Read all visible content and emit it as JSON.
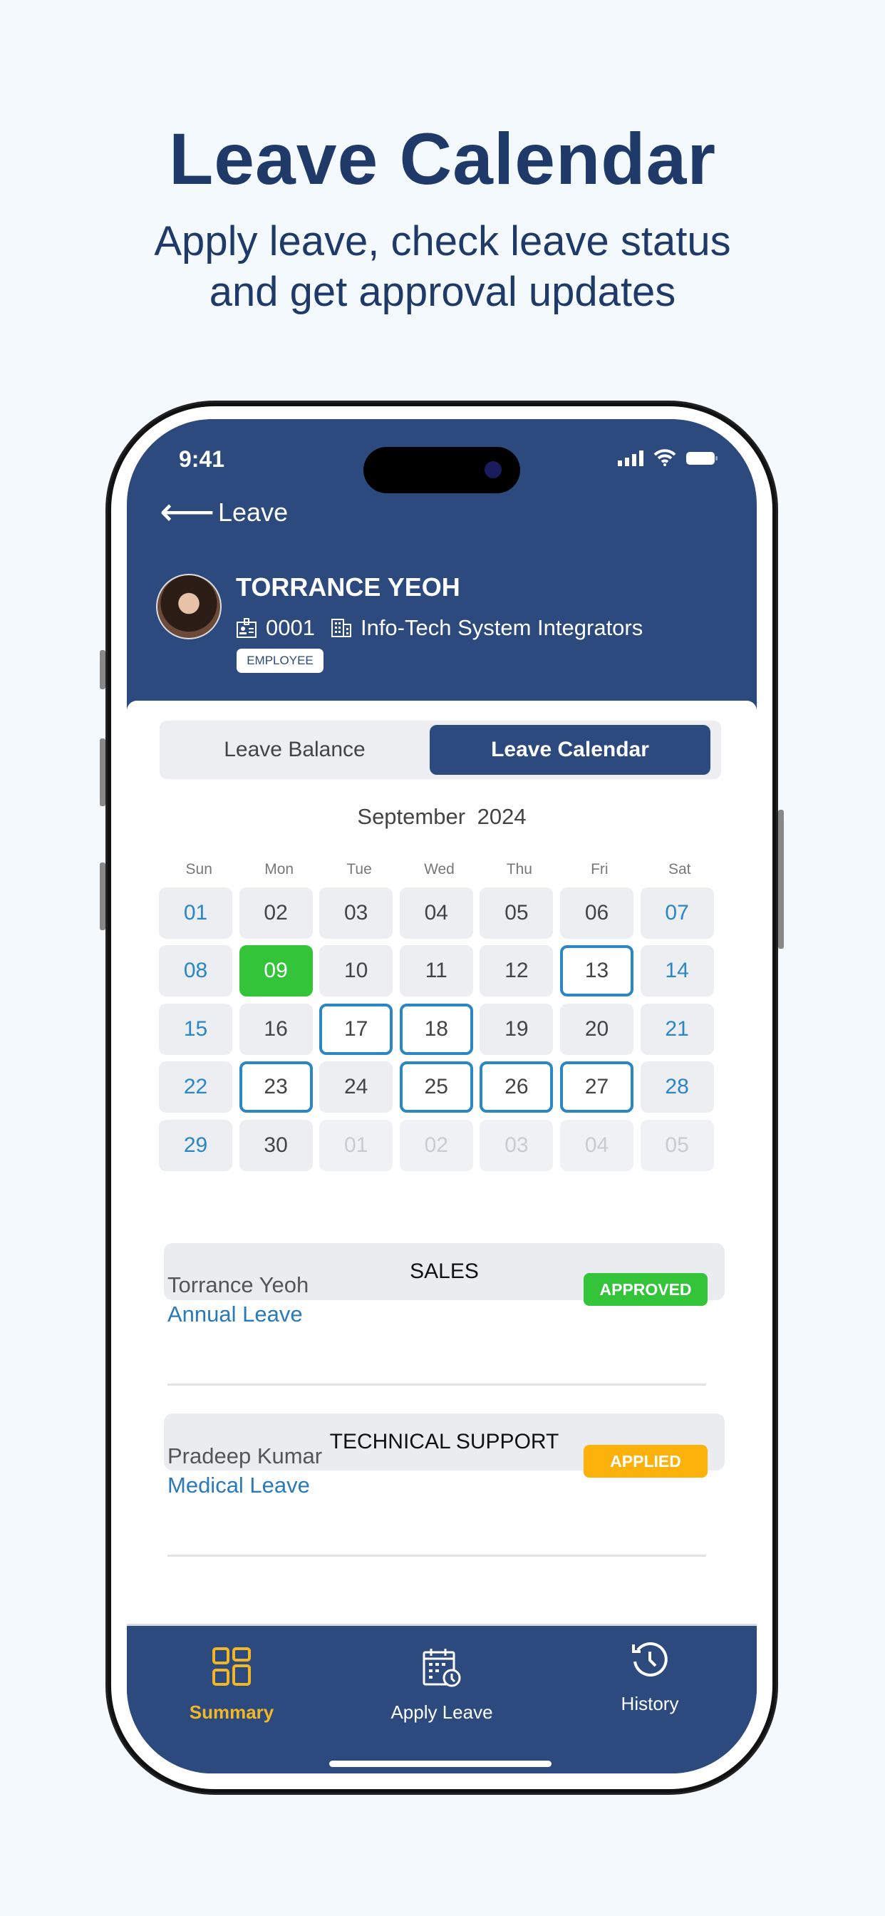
{
  "headline": "Leave Calendar",
  "subtitle": [
    "Apply leave, check leave status",
    "and get approval updates"
  ],
  "colors": {
    "brand": "#2c4a7e",
    "approved": "#33c43a",
    "applied": "#fdb10b",
    "accent": "#2a86c4",
    "nav_active": "#f2b824"
  },
  "status_bar": {
    "time": "9:41",
    "icons": [
      "signal-icon",
      "wifi-icon",
      "battery-icon"
    ]
  },
  "header": {
    "back_label": "Leave",
    "back_icon": "arrow-left-icon"
  },
  "profile": {
    "name": "TORRANCE YEOH",
    "employee_id": "0001",
    "company": "Info-Tech System Integrators",
    "role": "EMPLOYEE"
  },
  "tabs": [
    {
      "label": "Leave Balance",
      "active": false
    },
    {
      "label": "Leave Calendar",
      "active": true
    }
  ],
  "calendar": {
    "month": "September  2024",
    "weekdays": [
      "Sun",
      "Mon",
      "Tue",
      "Wed",
      "Thu",
      "Fri",
      "Sat"
    ],
    "days": [
      {
        "d": "01",
        "t": "weekend"
      },
      {
        "d": "02",
        "t": "day"
      },
      {
        "d": "03",
        "t": "day"
      },
      {
        "d": "04",
        "t": "day"
      },
      {
        "d": "05",
        "t": "day"
      },
      {
        "d": "06",
        "t": "day"
      },
      {
        "d": "07",
        "t": "weekend"
      },
      {
        "d": "08",
        "t": "weekend"
      },
      {
        "d": "09",
        "t": "today"
      },
      {
        "d": "10",
        "t": "day"
      },
      {
        "d": "11",
        "t": "day"
      },
      {
        "d": "12",
        "t": "day"
      },
      {
        "d": "13",
        "t": "outlined"
      },
      {
        "d": "14",
        "t": "weekend"
      },
      {
        "d": "15",
        "t": "weekend"
      },
      {
        "d": "16",
        "t": "day"
      },
      {
        "d": "17",
        "t": "outlined"
      },
      {
        "d": "18",
        "t": "outlined"
      },
      {
        "d": "19",
        "t": "day"
      },
      {
        "d": "20",
        "t": "day"
      },
      {
        "d": "21",
        "t": "weekend"
      },
      {
        "d": "22",
        "t": "weekend"
      },
      {
        "d": "23",
        "t": "outlined"
      },
      {
        "d": "24",
        "t": "day"
      },
      {
        "d": "25",
        "t": "outlined"
      },
      {
        "d": "26",
        "t": "outlined"
      },
      {
        "d": "27",
        "t": "outlined"
      },
      {
        "d": "28",
        "t": "weekend"
      },
      {
        "d": "29",
        "t": "weekend"
      },
      {
        "d": "30",
        "t": "day"
      },
      {
        "d": "01",
        "t": "muted"
      },
      {
        "d": "02",
        "t": "muted"
      },
      {
        "d": "03",
        "t": "muted"
      },
      {
        "d": "04",
        "t": "muted"
      },
      {
        "d": "05",
        "t": "muted"
      }
    ]
  },
  "groups": [
    {
      "department": "SALES",
      "employee": "Torrance Yeoh",
      "leave_type": "Annual Leave",
      "status": "APPROVED"
    },
    {
      "department": "TECHNICAL SUPPORT",
      "employee": "Pradeep Kumar",
      "leave_type": "Medical Leave",
      "status": "APPLIED"
    }
  ],
  "bottom_nav": [
    {
      "label": "Summary",
      "icon": "grid-icon",
      "active": true
    },
    {
      "label": "Apply Leave",
      "icon": "calendar-clock-icon",
      "active": false
    },
    {
      "label": "History",
      "icon": "history-icon",
      "active": false
    }
  ]
}
